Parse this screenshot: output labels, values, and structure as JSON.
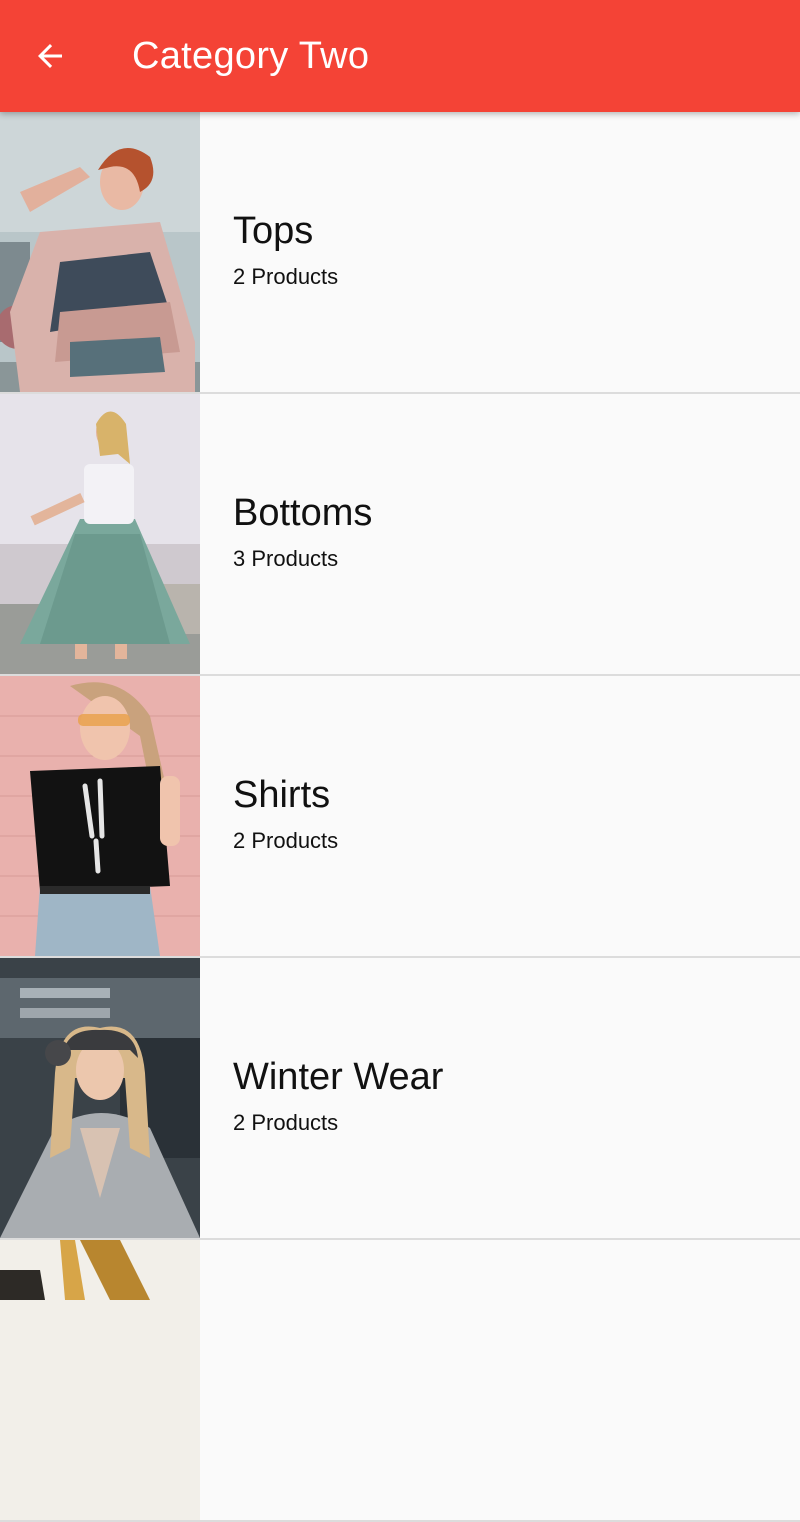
{
  "app_bar": {
    "title": "Category Two",
    "back_icon": "arrow-back-icon",
    "color": "#f44336"
  },
  "categories": [
    {
      "name": "Tops",
      "count": "2 Products",
      "image": "woman-in-patterned-shirt"
    },
    {
      "name": "Bottoms",
      "count": "3 Products",
      "image": "woman-in-teal-maxi-skirt"
    },
    {
      "name": "Shirts",
      "count": "2 Products",
      "image": "woman-in-skeleton-tshirt"
    },
    {
      "name": "Winter Wear",
      "count": "2 Products",
      "image": "woman-in-grey-coat"
    },
    {
      "name": "",
      "count": "",
      "image": "partial-category-image"
    }
  ]
}
